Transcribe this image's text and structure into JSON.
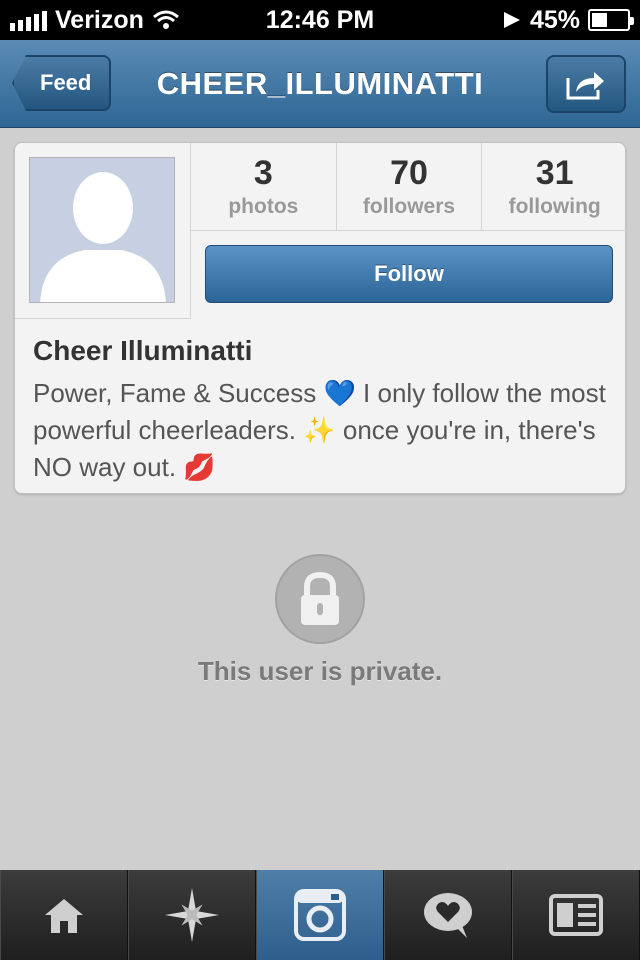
{
  "status_bar": {
    "carrier": "Verizon",
    "time": "12:46 PM",
    "battery_percent": "45%",
    "battery_level": 0.45,
    "signal_icon": "signal-bars-icon",
    "wifi_icon": "wifi-icon",
    "location_icon": "location-arrow-icon"
  },
  "nav": {
    "back_label": "Feed",
    "title": "CHEER_ILLUMINATTI",
    "share_icon": "share-icon"
  },
  "profile": {
    "stats": [
      {
        "value": "3",
        "label": "photos"
      },
      {
        "value": "70",
        "label": "followers"
      },
      {
        "value": "31",
        "label": "following"
      }
    ],
    "follow_label": "Follow",
    "name": "Cheer Illuminatti",
    "bio_part1": "Power, Fame & Success ",
    "bio_emoji1": "💙",
    "bio_part2": " I only follow the most powerful cheerleaders. ",
    "bio_emoji2": "✨",
    "bio_part3": " once you're in, there's NO way out. ",
    "bio_emoji3": "💋"
  },
  "private": {
    "message": "This user is private.",
    "icon": "lock-icon"
  },
  "tab_bar": {
    "tabs": [
      {
        "name": "home",
        "icon": "home-icon",
        "active": false
      },
      {
        "name": "explore",
        "icon": "explore-star-icon",
        "active": false
      },
      {
        "name": "camera",
        "icon": "camera-icon",
        "active": true
      },
      {
        "name": "news",
        "icon": "heart-bubble-icon",
        "active": false
      },
      {
        "name": "profile",
        "icon": "profile-card-icon",
        "active": false
      }
    ]
  },
  "colors": {
    "nav_blue": "#2f6693",
    "follow_blue": "#2b6497",
    "background": "#cfcfcf"
  }
}
